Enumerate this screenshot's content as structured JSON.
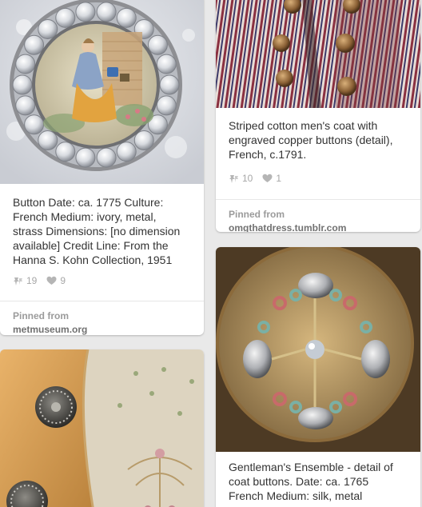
{
  "pins": [
    {
      "id": "pin-button-ivory",
      "image_desc": "round jeweled button with painted scene",
      "description": "Button Date: ca. 1775 Culture: French Medium: ivory, metal, strass Dimensions: [no dimension available] Credit Line: From the Hanna S. Kohn Collection, 1951",
      "description_lines": [
        "Button Date: ca. 1775 Culture:",
        "French Medium: ivory, metal,",
        "strass Dimensions: [no dimension",
        "available] Credit Line: From the",
        "Hanna S. Kohn Collection, 1951"
      ],
      "repins": "19",
      "likes": "9",
      "source_label": "Pinned from",
      "source_domain": "metmuseum.org"
    },
    {
      "id": "pin-striped-coat",
      "image_desc": "striped coat with copper buttons",
      "description_lines": [
        "Striped cotton men's coat with",
        "engraved copper buttons (detail),",
        "French, c.1791."
      ],
      "repins": "10",
      "likes": "1",
      "source_label": "Pinned from",
      "source_domain": "omgthatdress.tumblr.com"
    },
    {
      "id": "pin-embroidered-waistcoat",
      "image_desc": "embroidered waistcoat with buttons"
    },
    {
      "id": "pin-gentleman-ensemble",
      "image_desc": "ornate embroidered button",
      "description_lines": [
        "Gentleman's Ensemble - detail of",
        "coat buttons. Date: ca. 1765",
        "French Medium: silk, metal"
      ]
    }
  ],
  "icons": {
    "repin": "pin-icon",
    "like": "heart-icon"
  },
  "colors": {
    "background": "#e9e9e9",
    "card": "#ffffff",
    "text": "#333333",
    "muted": "#a7a7a7"
  }
}
